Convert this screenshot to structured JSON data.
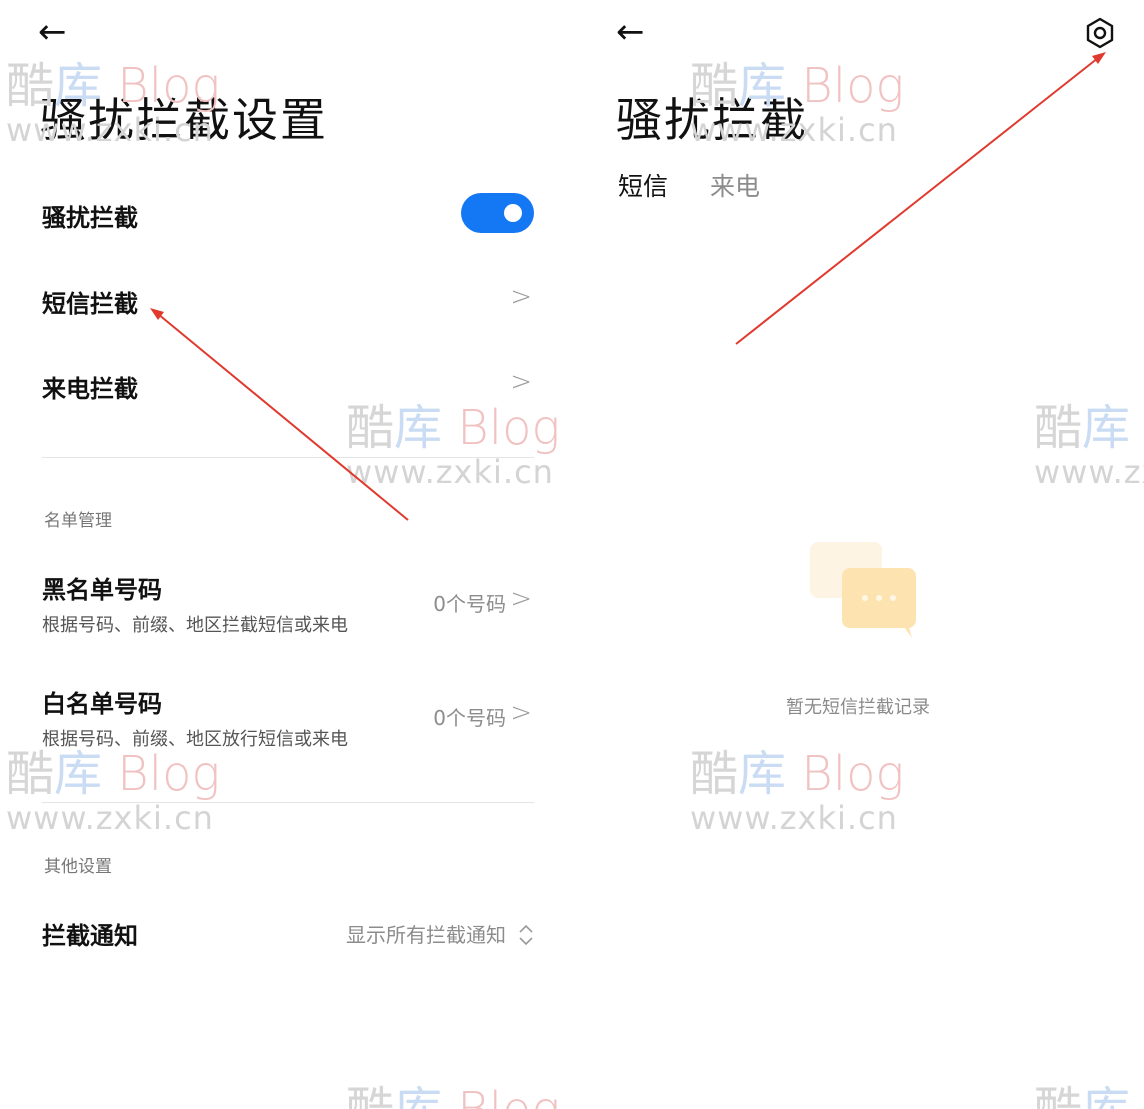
{
  "left": {
    "back_icon": "arrow-left-icon",
    "title": "骚扰拦截设置",
    "toggle_row": {
      "label": "骚扰拦截",
      "enabled": true,
      "accent": "#1478f5"
    },
    "sms_row": {
      "label": "短信拦截"
    },
    "call_row": {
      "label": "来电拦截"
    },
    "list_section": "名单管理",
    "blacklist": {
      "label": "黑名单号码",
      "sub": "根据号码、前缀、地区拦截短信或来电",
      "value": "0个号码"
    },
    "whitelist": {
      "label": "白名单号码",
      "sub": "根据号码、前缀、地区放行短信或来电",
      "value": "0个号码"
    },
    "other_section": "其他设置",
    "notify_row": {
      "label": "拦截通知",
      "value": "显示所有拦截通知"
    }
  },
  "right": {
    "back_icon": "arrow-left-icon",
    "settings_icon": "gear-icon",
    "title": "骚扰拦截",
    "tabs": [
      {
        "label": "短信",
        "active": true
      },
      {
        "label": "来电",
        "active": false
      }
    ],
    "empty_text": "暂无短信拦截记录"
  },
  "watermark": {
    "logo_cn": "酷",
    "logo_ku": "库",
    "logo_blog": "Blog",
    "url": "www.zxki.cn"
  },
  "annotation_color": "#e03a2e"
}
